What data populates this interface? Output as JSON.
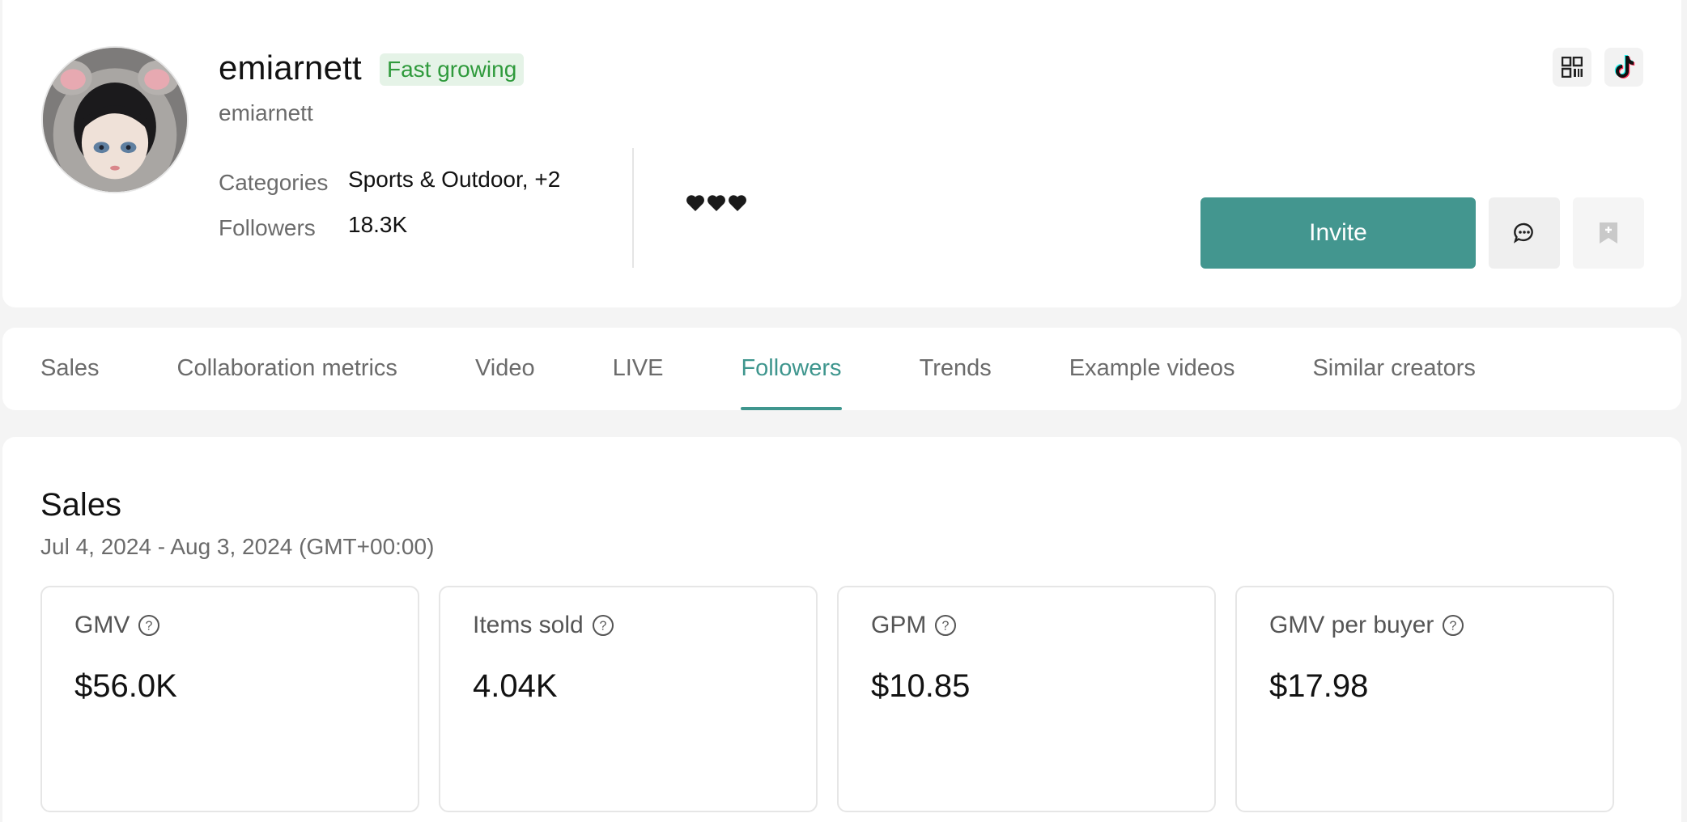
{
  "profile": {
    "name": "emiarnett",
    "badge": "Fast growing",
    "handle": "emiarnett",
    "categories_label": "Categories",
    "categories_value": "Sports & Outdoor, +2",
    "followers_label": "Followers",
    "followers_value": "18.3K",
    "hearts_icon": "black-heart-icon",
    "hearts_count": 3
  },
  "actions": {
    "invite_label": "Invite",
    "message_icon": "chat-bubble-icon",
    "save_icon": "bookmark-add-icon",
    "qr_icon": "qr-code-icon",
    "tiktok_icon": "tiktok-logo-icon"
  },
  "tabs": [
    {
      "label": "Sales",
      "active": false
    },
    {
      "label": "Collaboration metrics",
      "active": false
    },
    {
      "label": "Video",
      "active": false
    },
    {
      "label": "LIVE",
      "active": false
    },
    {
      "label": "Followers",
      "active": true
    },
    {
      "label": "Trends",
      "active": false
    },
    {
      "label": "Example videos",
      "active": false
    },
    {
      "label": "Similar creators",
      "active": false
    }
  ],
  "sales": {
    "title": "Sales",
    "date_range": "Jul 4, 2024 - Aug 3, 2024 (GMT+00:00)",
    "metrics": [
      {
        "label": "GMV",
        "value": "$56.0K"
      },
      {
        "label": "Items sold",
        "value": "4.04K"
      },
      {
        "label": "GPM",
        "value": "$10.85"
      },
      {
        "label": "GMV per buyer",
        "value": "$17.98"
      }
    ]
  },
  "colors": {
    "accent": "#43968f",
    "badge_bg": "#e5f3e7",
    "badge_text": "#2f9a3c",
    "page_bg": "#f4f4f4"
  }
}
